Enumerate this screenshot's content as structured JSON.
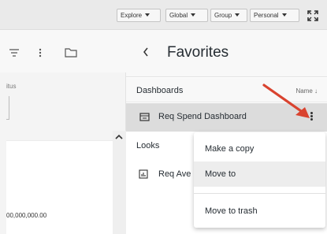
{
  "topbar": {
    "filters": [
      {
        "label": "Explore"
      },
      {
        "label": "Global"
      },
      {
        "label": "Group"
      },
      {
        "label": "Personal"
      }
    ],
    "expand_icon": "expand-icon"
  },
  "left_panel": {
    "toolbar_icons": [
      "filter-icon",
      "kebab-icon",
      "folder-icon"
    ],
    "status_label": "itus",
    "value_text": "00,000,000.00"
  },
  "favorites": {
    "back_icon": "chevron-left-icon",
    "title": "Favorites",
    "dashboards": {
      "label": "Dashboards",
      "sort_label": "Name ↓",
      "items": [
        {
          "label": "Req Spend Dashboard",
          "icon": "dashboard-icon"
        }
      ]
    },
    "looks": {
      "label": "Looks",
      "items": [
        {
          "label": "Req Ave",
          "icon": "look-icon"
        }
      ]
    }
  },
  "context_menu": {
    "items": [
      {
        "label": "Make a copy"
      },
      {
        "label": "Move to"
      },
      {
        "label": "Move to trash"
      }
    ]
  },
  "colors": {
    "annotation_arrow": "#d9432f",
    "selected_row": "#dcdcdc",
    "hover_item": "#ededed"
  }
}
